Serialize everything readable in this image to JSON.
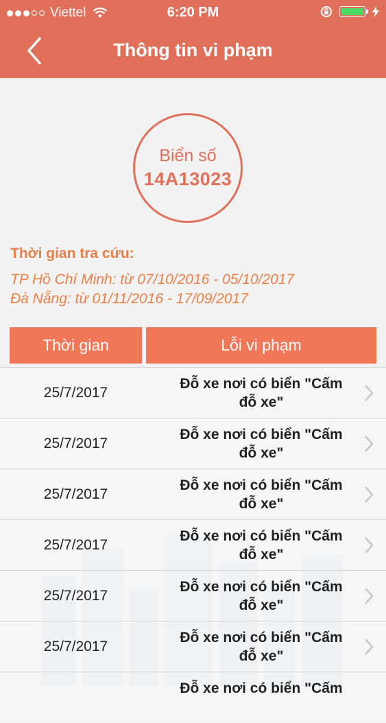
{
  "status_bar": {
    "carrier": "Viettel",
    "signal_filled": 3,
    "signal_total": 5,
    "time": "6:20 PM",
    "battery_level": 1.0
  },
  "nav": {
    "title": "Thông tin vi phạm"
  },
  "plate": {
    "label": "Biển số",
    "value": "14A13023"
  },
  "lookup": {
    "title": "Thời gian tra cứu:",
    "lines": [
      "TP Hồ Chí Minh: từ 07/10/2016 - 05/10/2017",
      "Đà Nẵng: từ 01/11/2016 - 17/09/2017"
    ]
  },
  "table": {
    "headers": [
      "Thời gian",
      "Lỗi vi phạm"
    ],
    "rows": [
      {
        "date": "25/7/2017",
        "violation_line1": "Đỗ xe nơi có biển \"Cấm",
        "violation_line2": "đỗ xe\""
      },
      {
        "date": "25/7/2017",
        "violation_line1": "Đỗ xe nơi có biển \"Cấm",
        "violation_line2": "đỗ xe\""
      },
      {
        "date": "25/7/2017",
        "violation_line1": "Đỗ xe nơi có biển \"Cấm",
        "violation_line2": "đỗ xe\""
      },
      {
        "date": "25/7/2017",
        "violation_line1": "Đỗ xe nơi có biển \"Cấm",
        "violation_line2": "đỗ xe\""
      },
      {
        "date": "25/7/2017",
        "violation_line1": "Đỗ xe nơi có biển \"Cấm",
        "violation_line2": "đỗ xe\""
      },
      {
        "date": "25/7/2017",
        "violation_line1": "Đỗ xe nơi có biển \"Cấm",
        "violation_line2": "đỗ xe\""
      },
      {
        "date": "",
        "violation_line1": "Đỗ xe nơi có biển \"Cấm",
        "violation_line2": ""
      }
    ]
  },
  "colors": {
    "header": "#e0705a",
    "accent": "#e8804a",
    "table_header": "#f07758"
  },
  "icons": [
    "back-icon",
    "wifi-icon",
    "rotation-lock-icon",
    "battery-icon",
    "charging-icon",
    "chevron-right-icon"
  ]
}
